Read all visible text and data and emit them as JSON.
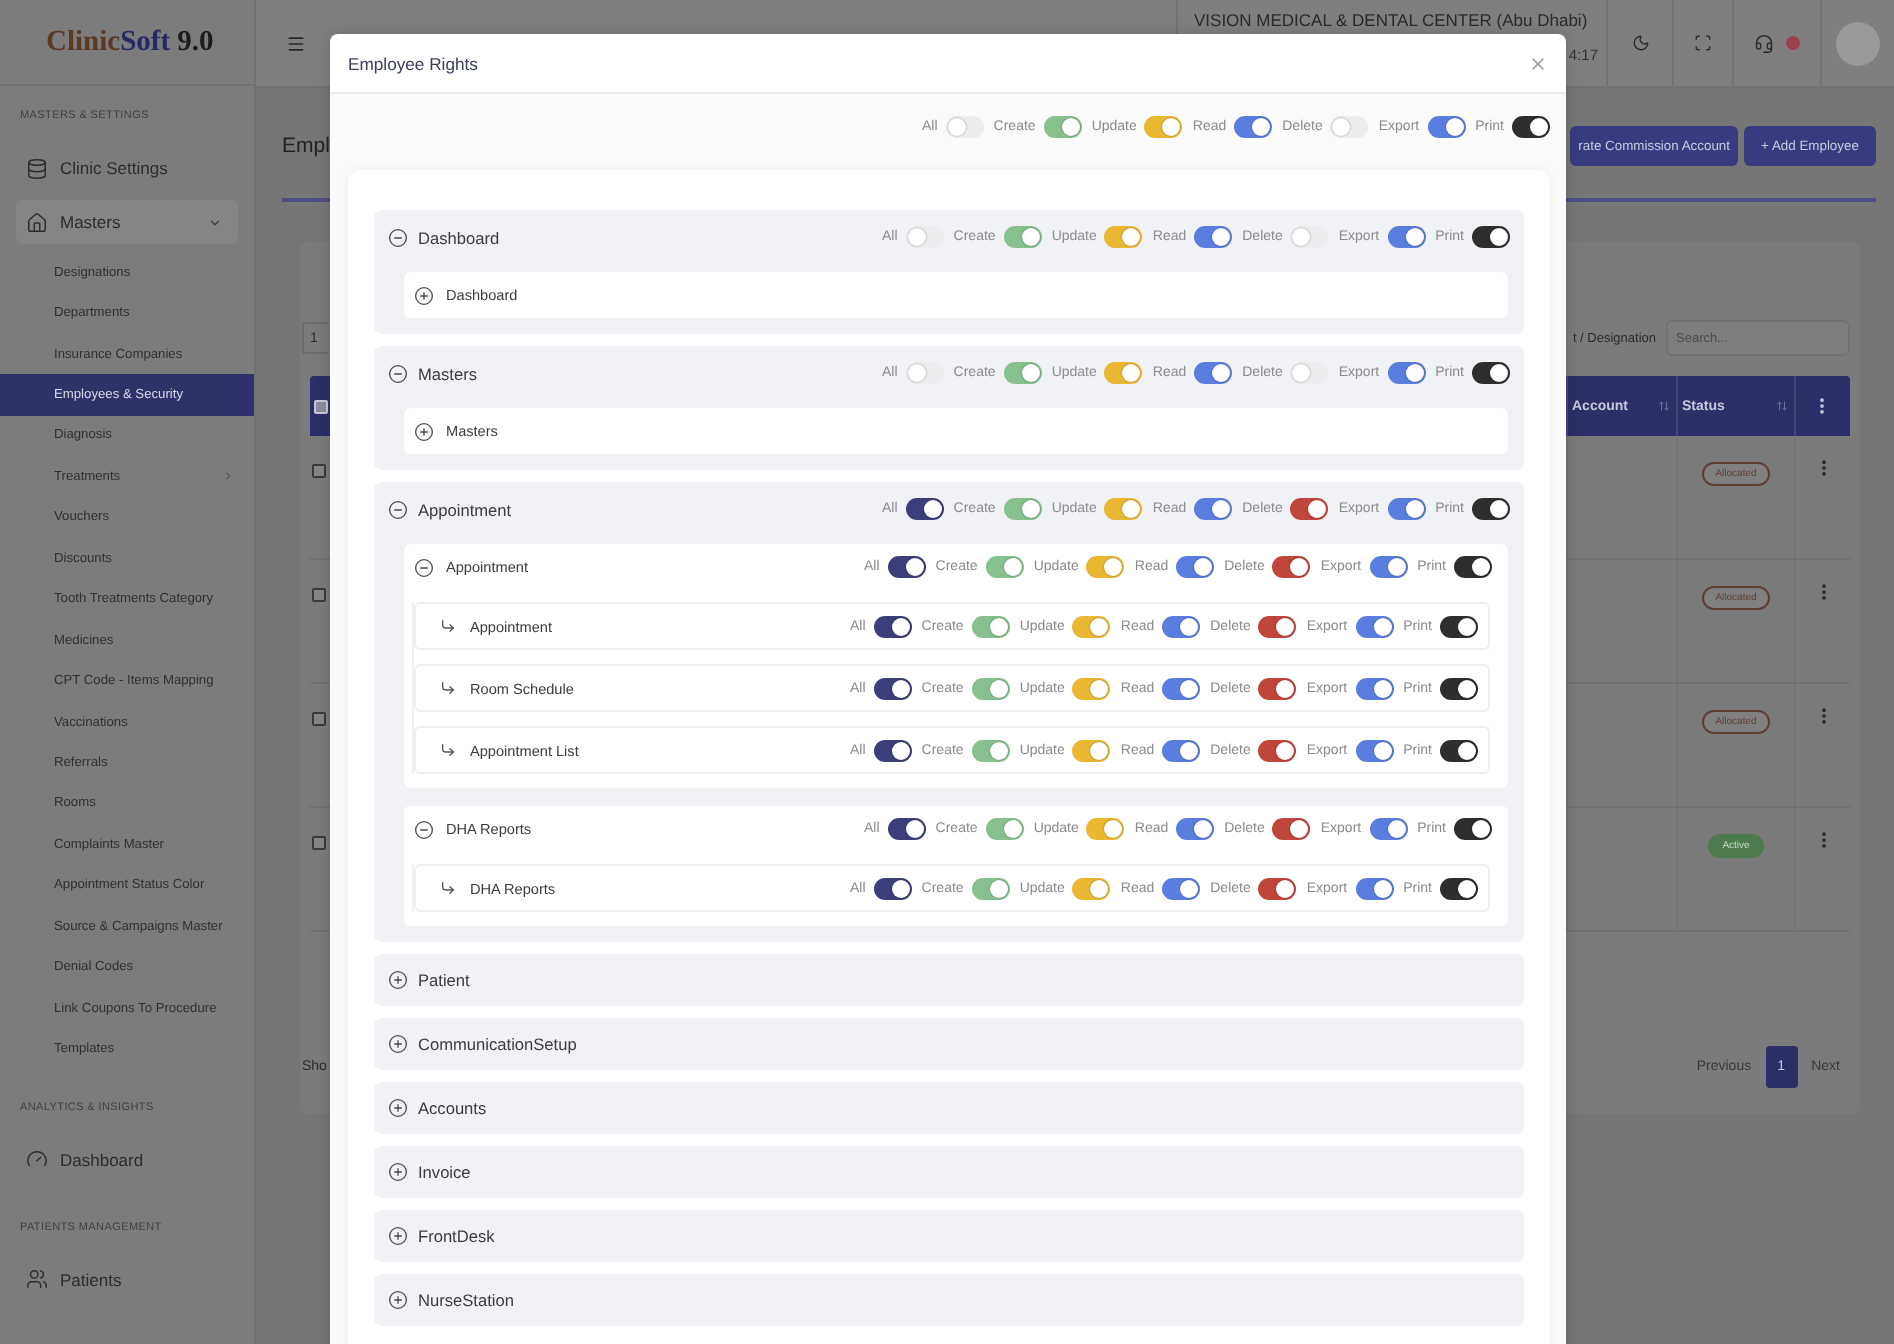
{
  "sidebar": {
    "logo": {
      "name_start": "Clinic",
      "name_end": "Soft",
      "version": "9.0"
    },
    "sections": [
      {
        "title": "MASTERS & SETTINGS",
        "items": [
          {
            "label": "Clinic Settings"
          },
          {
            "label": "Masters",
            "expanded": true,
            "children": [
              {
                "label": "Designations",
                "kind": "link",
                "selected": false
              },
              {
                "label": "Departments",
                "kind": "link",
                "selected": false
              },
              {
                "label": "Insurance Companies",
                "kind": "link",
                "selected": false
              },
              {
                "label": "Employees & Security",
                "kind": "link",
                "selected": true
              },
              {
                "label": "Diagnosis",
                "kind": "link",
                "selected": false
              },
              {
                "label": "Treatments",
                "kind": "group",
                "selected": false
              },
              {
                "label": "Vouchers",
                "kind": "link",
                "selected": false
              },
              {
                "label": "Discounts",
                "kind": "link",
                "selected": false
              },
              {
                "label": "Tooth Treatments Category",
                "kind": "link",
                "selected": false
              },
              {
                "label": "Medicines",
                "kind": "link",
                "selected": false
              },
              {
                "label": "CPT Code - Items Mapping",
                "kind": "link",
                "selected": false
              },
              {
                "label": "Vaccinations",
                "kind": "link",
                "selected": false
              },
              {
                "label": "Referrals",
                "kind": "link",
                "selected": false
              },
              {
                "label": "Rooms",
                "kind": "link",
                "selected": false
              },
              {
                "label": "Complaints Master",
                "kind": "link",
                "selected": false
              },
              {
                "label": "Appointment Status Color",
                "kind": "link",
                "selected": false
              },
              {
                "label": "Source & Campaigns Master",
                "kind": "link",
                "selected": false
              },
              {
                "label": "Denial Codes",
                "kind": "link",
                "selected": false
              },
              {
                "label": "Link Coupons To Procedure",
                "kind": "link",
                "selected": false
              },
              {
                "label": "Templates",
                "kind": "link",
                "selected": false
              }
            ]
          }
        ]
      },
      {
        "title": "ANALYTICS & INSIGHTS",
        "items": [
          {
            "label": "Dashboard"
          }
        ]
      },
      {
        "title": "PATIENTS MANAGEMENT",
        "items": [
          {
            "label": "Patients"
          }
        ]
      }
    ]
  },
  "topbar": {
    "org_name": "VISION MEDICAL & DENTAL CENTER (Abu Dhabi)",
    "time": "4:17"
  },
  "page": {
    "title": "Empl",
    "buttons": [
      "rate Commission Account",
      "+ Add Employee"
    ],
    "table": {
      "page_size": "1",
      "search_label": "t / Designation",
      "search_placeholder": "Search...",
      "header_checked": false,
      "columns": [
        "Account",
        "Status"
      ],
      "rows": [
        {
          "checked": false,
          "status": {
            "label": "Allocated",
            "kind": "outline"
          }
        },
        {
          "checked": false,
          "status": {
            "label": "Allocated",
            "kind": "outline"
          }
        },
        {
          "checked": false,
          "status": {
            "label": "Allocated",
            "kind": "outline"
          }
        },
        {
          "checked": false,
          "status": {
            "label": "Active",
            "kind": "filled"
          }
        }
      ],
      "footer_text": "Sho",
      "pagination": {
        "previous": {
          "label": "Previous",
          "disabled": true
        },
        "pages": [
          {
            "label": "1",
            "selected": true
          }
        ],
        "next": {
          "label": "Next",
          "disabled": true
        }
      }
    }
  },
  "modal": {
    "title": "Employee Rights",
    "permissions": [
      {
        "label": "All",
        "on": false
      },
      {
        "label": "Create",
        "on": true
      },
      {
        "label": "Update",
        "on": true
      },
      {
        "label": "Read",
        "on": true
      },
      {
        "label": "Delete",
        "on": false
      },
      {
        "label": "Export",
        "on": true
      },
      {
        "label": "Print",
        "on": true
      }
    ],
    "modules": [
      {
        "name": "Dashboard",
        "expanded": true,
        "permissions": [
          {
            "label": "All",
            "on": false
          },
          {
            "label": "Create",
            "on": true
          },
          {
            "label": "Update",
            "on": true
          },
          {
            "label": "Read",
            "on": true
          },
          {
            "label": "Delete",
            "on": false
          },
          {
            "label": "Export",
            "on": true
          },
          {
            "label": "Print",
            "on": true
          }
        ],
        "children": [
          {
            "name": "Dashboard",
            "expanded": false
          }
        ]
      },
      {
        "name": "Masters",
        "expanded": true,
        "permissions": [
          {
            "label": "All",
            "on": false
          },
          {
            "label": "Create",
            "on": true
          },
          {
            "label": "Update",
            "on": true
          },
          {
            "label": "Read",
            "on": true
          },
          {
            "label": "Delete",
            "on": false
          },
          {
            "label": "Export",
            "on": true
          },
          {
            "label": "Print",
            "on": true
          }
        ],
        "children": [
          {
            "name": "Masters",
            "expanded": false
          }
        ]
      },
      {
        "name": "Appointment",
        "expanded": true,
        "permissions": [
          {
            "label": "All",
            "on": true
          },
          {
            "label": "Create",
            "on": true
          },
          {
            "label": "Update",
            "on": true
          },
          {
            "label": "Read",
            "on": true
          },
          {
            "label": "Delete",
            "on": true
          },
          {
            "label": "Export",
            "on": true
          },
          {
            "label": "Print",
            "on": true
          }
        ],
        "children": [
          {
            "name": "Appointment",
            "expanded": true,
            "permissions": [
              {
                "label": "All",
                "on": true
              },
              {
                "label": "Create",
                "on": true
              },
              {
                "label": "Update",
                "on": true
              },
              {
                "label": "Read",
                "on": true
              },
              {
                "label": "Delete",
                "on": true
              },
              {
                "label": "Export",
                "on": true
              },
              {
                "label": "Print",
                "on": true
              }
            ],
            "children": [
              {
                "name": "Appointment",
                "permissions": [
                  {
                    "label": "All",
                    "on": true
                  },
                  {
                    "label": "Create",
                    "on": true
                  },
                  {
                    "label": "Update",
                    "on": true
                  },
                  {
                    "label": "Read",
                    "on": true
                  },
                  {
                    "label": "Delete",
                    "on": true
                  },
                  {
                    "label": "Export",
                    "on": true
                  },
                  {
                    "label": "Print",
                    "on": true
                  }
                ]
              },
              {
                "name": "Room Schedule",
                "permissions": [
                  {
                    "label": "All",
                    "on": true
                  },
                  {
                    "label": "Create",
                    "on": true
                  },
                  {
                    "label": "Update",
                    "on": true
                  },
                  {
                    "label": "Read",
                    "on": true
                  },
                  {
                    "label": "Delete",
                    "on": true
                  },
                  {
                    "label": "Export",
                    "on": true
                  },
                  {
                    "label": "Print",
                    "on": true
                  }
                ]
              },
              {
                "name": "Appointment List",
                "permissions": [
                  {
                    "label": "All",
                    "on": true
                  },
                  {
                    "label": "Create",
                    "on": true
                  },
                  {
                    "label": "Update",
                    "on": true
                  },
                  {
                    "label": "Read",
                    "on": true
                  },
                  {
                    "label": "Delete",
                    "on": true
                  },
                  {
                    "label": "Export",
                    "on": true
                  },
                  {
                    "label": "Print",
                    "on": true
                  }
                ]
              }
            ]
          },
          {
            "name": "DHA Reports",
            "expanded": true,
            "permissions": [
              {
                "label": "All",
                "on": true
              },
              {
                "label": "Create",
                "on": true
              },
              {
                "label": "Update",
                "on": true
              },
              {
                "label": "Read",
                "on": true
              },
              {
                "label": "Delete",
                "on": true
              },
              {
                "label": "Export",
                "on": true
              },
              {
                "label": "Print",
                "on": true
              }
            ],
            "children": [
              {
                "name": "DHA Reports",
                "permissions": [
                  {
                    "label": "All",
                    "on": true
                  },
                  {
                    "label": "Create",
                    "on": true
                  },
                  {
                    "label": "Update",
                    "on": true
                  },
                  {
                    "label": "Read",
                    "on": true
                  },
                  {
                    "label": "Delete",
                    "on": true
                  },
                  {
                    "label": "Export",
                    "on": true
                  },
                  {
                    "label": "Print",
                    "on": true
                  }
                ]
              }
            ]
          }
        ]
      },
      {
        "name": "Patient",
        "expanded": false
      },
      {
        "name": "CommunicationSetup",
        "expanded": false
      },
      {
        "name": "Accounts",
        "expanded": false
      },
      {
        "name": "Invoice",
        "expanded": false
      },
      {
        "name": "FrontDesk",
        "expanded": false
      },
      {
        "name": "NurseStation",
        "expanded": false
      }
    ]
  }
}
